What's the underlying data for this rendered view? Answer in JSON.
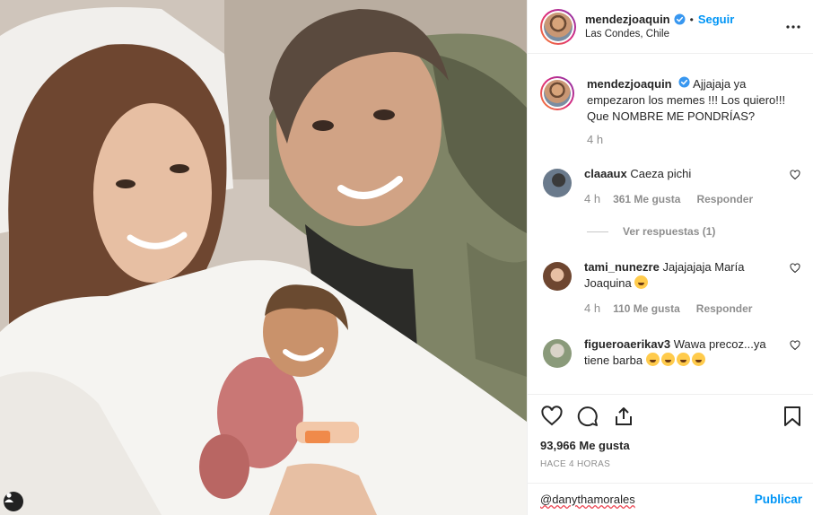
{
  "post": {
    "username": "mendezjoaquin",
    "verified": true,
    "dot": "•",
    "follow_label": "Seguir",
    "location": "Las Condes, Chile",
    "caption": "Ajjajaja ya empezaron los memes !!! Los quiero!!! Que NOMBRE ME PONDRÍAS?",
    "caption_time": "4 h"
  },
  "comments": [
    {
      "username": "claaaux",
      "text": "Caeza pichi",
      "time": "4 h",
      "likes": "361 Me gusta",
      "reply": "Responder",
      "view_replies": "Ver respuestas (1)",
      "avatar_color": "#6a7a8c"
    },
    {
      "username": "tami_nunezre",
      "text": "Jajajajaja María Joaquina",
      "emoji": "grinning-face",
      "time": "4 h",
      "likes": "110 Me gusta",
      "reply": "Responder",
      "avatar_color": "#b98f6f"
    },
    {
      "username": "figueroaerikav3",
      "text": "Wawa precoz...ya tiene barba",
      "emoji": "rolling-laughing-face x4",
      "avatar_color": "#8a9a7a"
    }
  ],
  "actions": {
    "likes": "93,966 Me gusta",
    "time_ago": "HACE 4 HORAS"
  },
  "add_comment": {
    "mention": "@danythamorales",
    "publish_label": "Publicar"
  },
  "colors": {
    "link_blue": "#0095f6",
    "muted_gray": "#8e8e8e",
    "border": "#efefef"
  }
}
